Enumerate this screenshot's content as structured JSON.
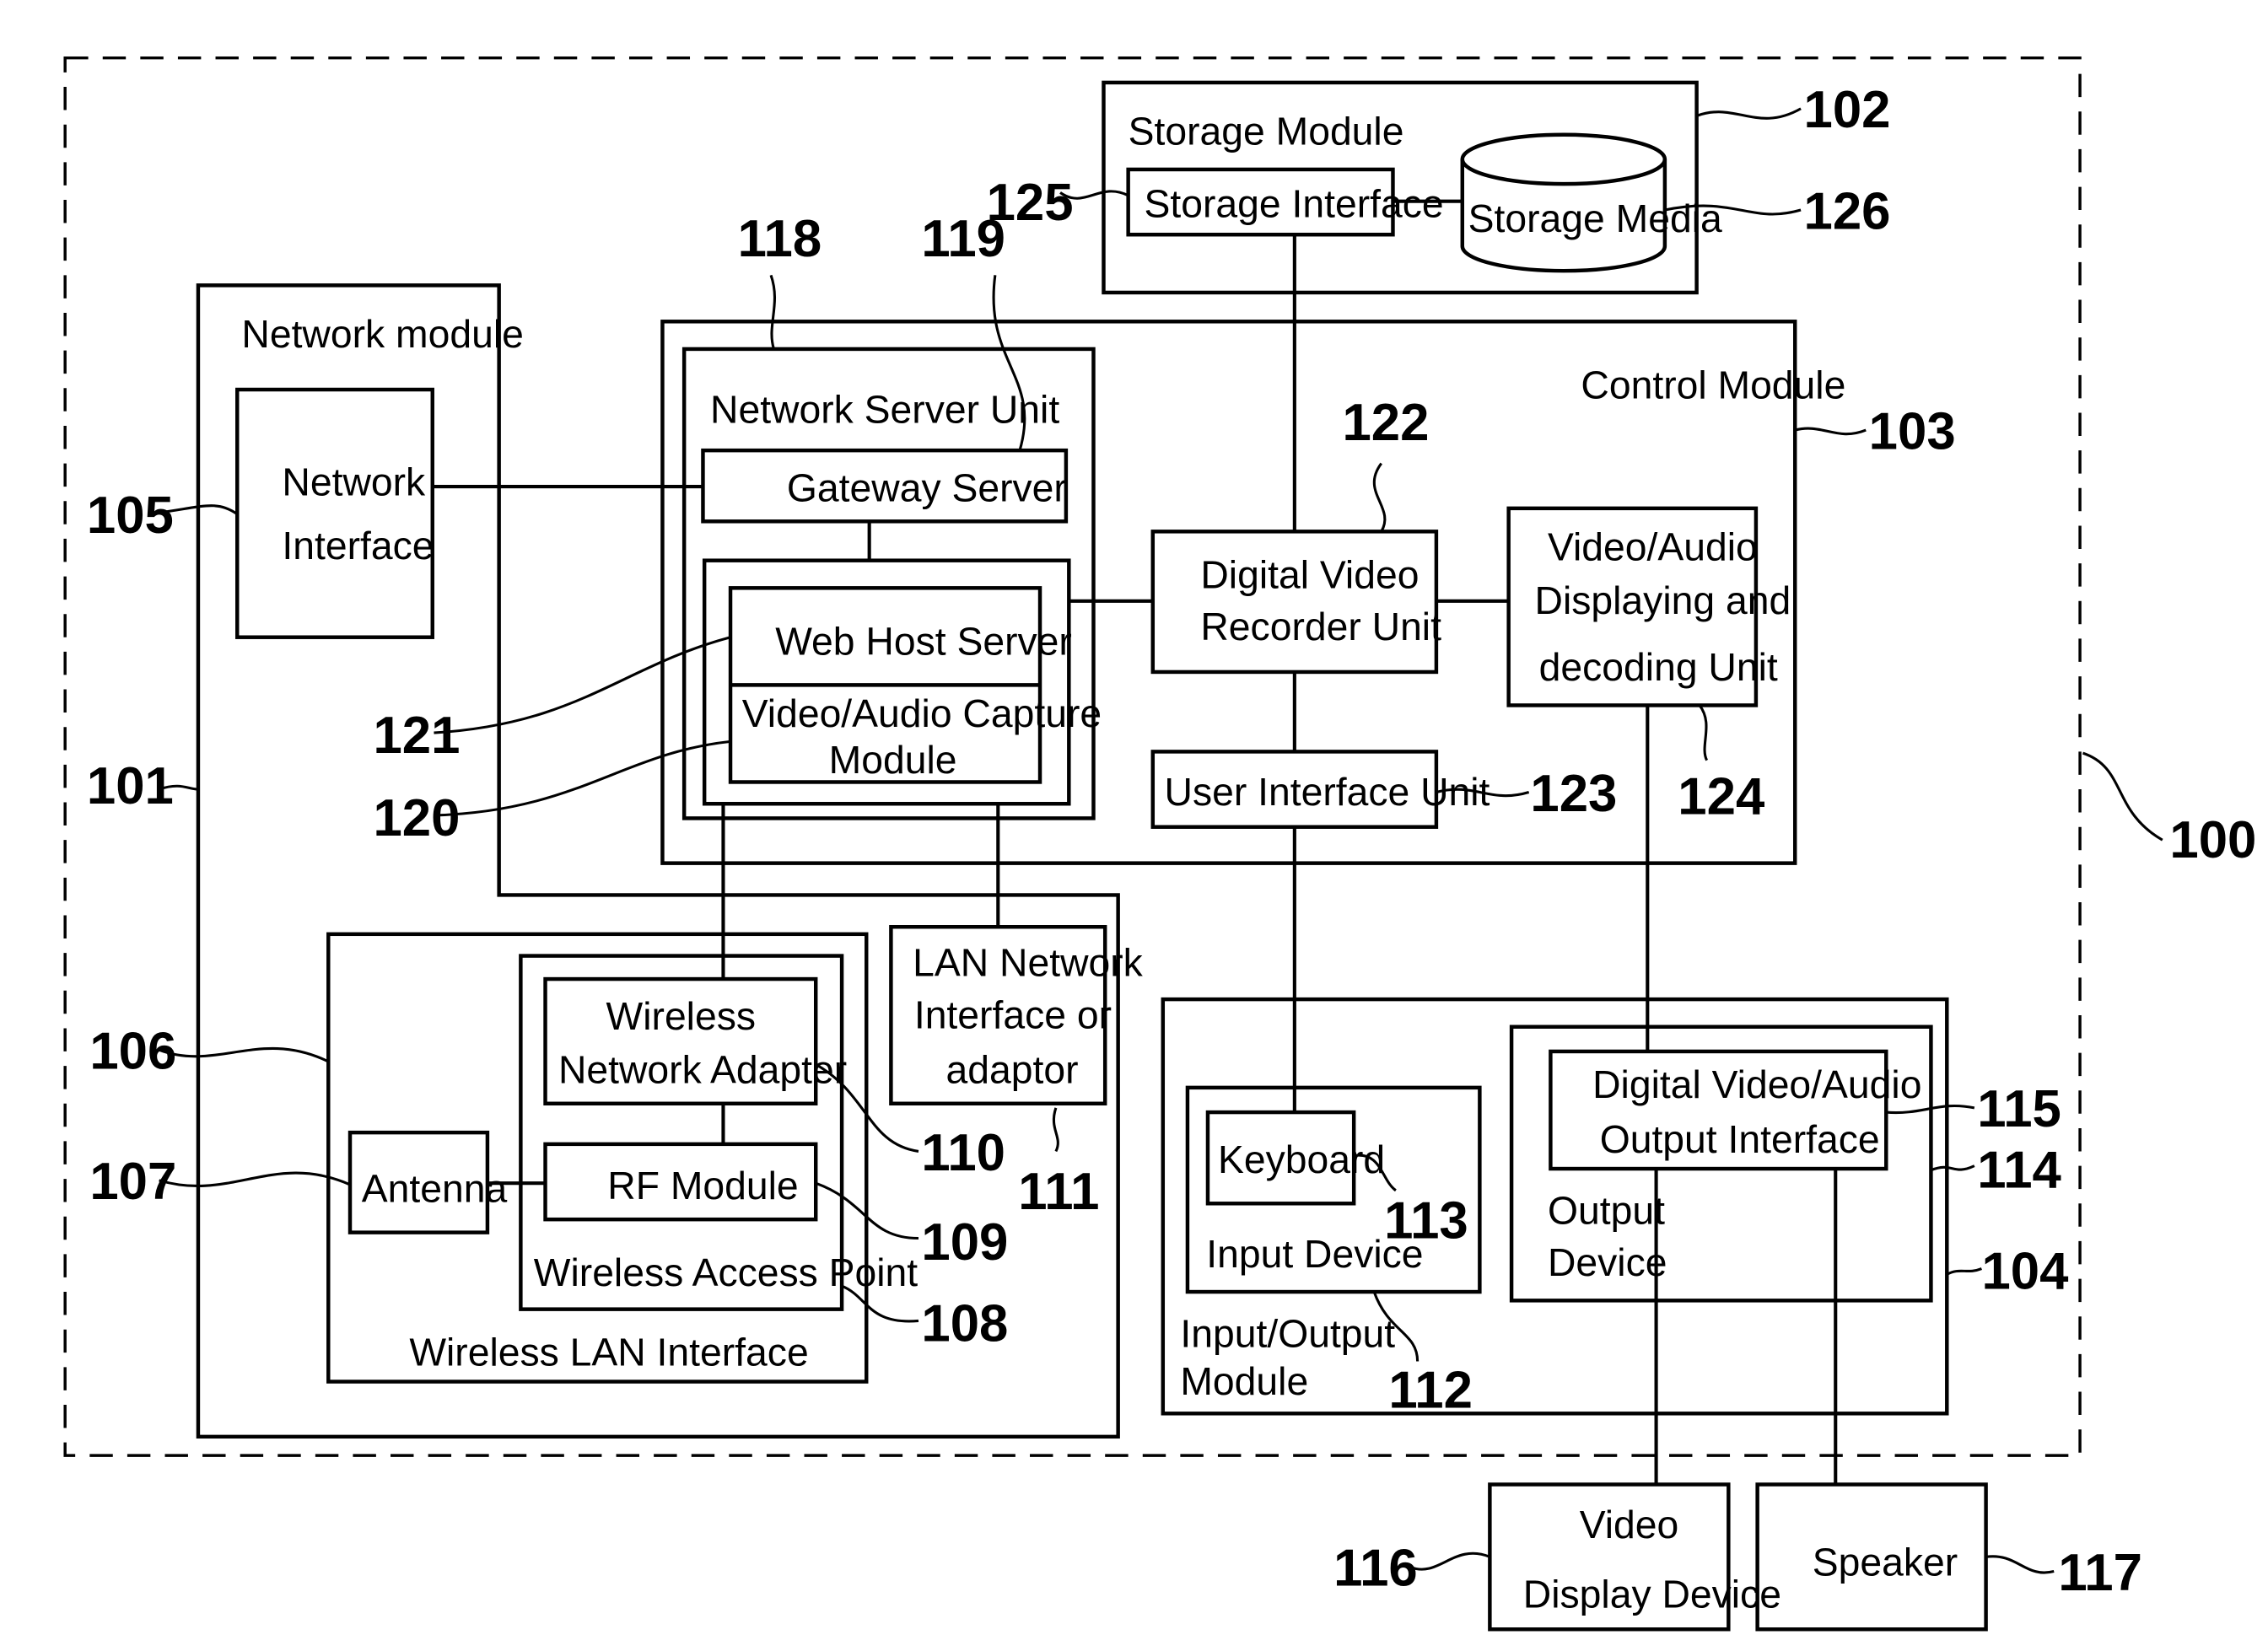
{
  "figure": {
    "system_ref": "100",
    "modules": {
      "network_module": {
        "label": "Network module",
        "ref": "101"
      },
      "storage_module": {
        "label": "Storage Module",
        "ref": "102"
      },
      "control_module": {
        "label": "Control Module",
        "ref": "103"
      },
      "io_module": {
        "label_line1": "Input/Output",
        "label_line2": "Module",
        "ref": "104"
      }
    },
    "blocks": {
      "network_interface": {
        "line1": "Network",
        "line2": "Interface",
        "ref": "105"
      },
      "wireless_lan_interface": {
        "label": "Wireless LAN Interface",
        "ref": "106"
      },
      "antenna": {
        "label": "Antenna",
        "ref": "107"
      },
      "wireless_access_point": {
        "label": "Wireless Access Point",
        "ref": "108"
      },
      "rf_module": {
        "label": "RF Module",
        "ref": "109"
      },
      "wireless_network_adapter": {
        "line1": "Wireless",
        "line2": "Network Adapter",
        "ref": "110"
      },
      "lan_network_interface": {
        "line1": "LAN Network",
        "line2": "Interface or",
        "line3": "adaptor",
        "ref": "111"
      },
      "input_device": {
        "label": "Input Device",
        "ref": "112"
      },
      "keyboard": {
        "label": "Keyboard",
        "ref": "113"
      },
      "output_device": {
        "line1": "Output",
        "line2": "Device",
        "ref": "114"
      },
      "dva_output_interface": {
        "line1": "Digital Video/Audio",
        "line2": "Output Interface",
        "ref": "115"
      },
      "video_display_device": {
        "line1": "Video",
        "line2": "Display Device",
        "ref": "116"
      },
      "speaker": {
        "label": "Speaker",
        "ref": "117"
      },
      "network_server_unit": {
        "label": "Network Server Unit",
        "ref": "118"
      },
      "gateway_server": {
        "label": "Gateway Server",
        "ref": "119"
      },
      "va_capture_module": {
        "line1": "Video/Audio Capture",
        "line2": "Module",
        "ref": "120"
      },
      "web_host_server": {
        "label": "Web Host Server",
        "ref": "121"
      },
      "dvr_unit": {
        "line1": "Digital Video",
        "line2": "Recorder Unit",
        "ref": "122"
      },
      "user_interface_unit": {
        "label": "User Interface Unit",
        "ref": "123"
      },
      "va_display_decoding_unit": {
        "line1": "Video/Audio",
        "line2": "Displaying and",
        "line3": "decoding Unit",
        "ref": "124"
      },
      "storage_interface": {
        "label": "Storage Interface",
        "ref": "125"
      },
      "storage_media": {
        "label": "Storage Media",
        "ref": "126"
      }
    }
  }
}
